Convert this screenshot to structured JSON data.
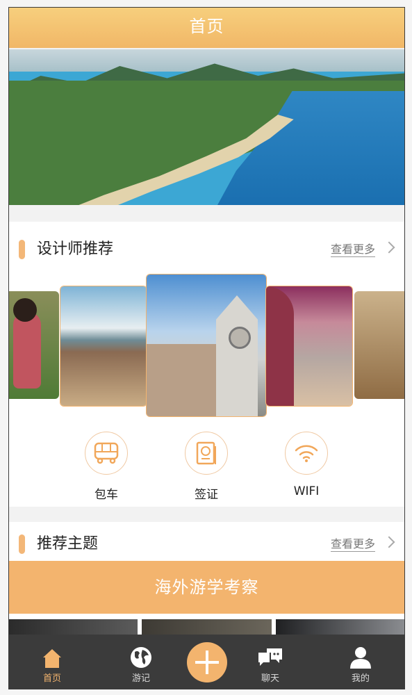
{
  "header": {
    "title": "首页"
  },
  "banner": {
    "pages": 3,
    "active_index": 1
  },
  "designer_section": {
    "title": "设计师推荐",
    "more_label": "查看更多"
  },
  "services": [
    {
      "icon": "bus-icon",
      "label": "包车"
    },
    {
      "icon": "passport-icon",
      "label": "签证"
    },
    {
      "icon": "wifi-icon",
      "label": "WIFI"
    }
  ],
  "theme_section": {
    "title": "推荐主题",
    "more_label": "查看更多",
    "banner_label": "海外游学考察"
  },
  "tabbar": {
    "items": [
      {
        "icon": "home-icon",
        "label": "首页",
        "active": true
      },
      {
        "icon": "globe-icon",
        "label": "游记",
        "active": false
      },
      {
        "icon": "plus-icon",
        "label": "",
        "active": false
      },
      {
        "icon": "chat-icon",
        "label": "聊天",
        "active": false
      },
      {
        "icon": "user-icon",
        "label": "我的",
        "active": false
      }
    ]
  },
  "colors": {
    "accent": "#f3b46e",
    "header": "#f2c070",
    "tabbar": "#3b3b3b"
  }
}
